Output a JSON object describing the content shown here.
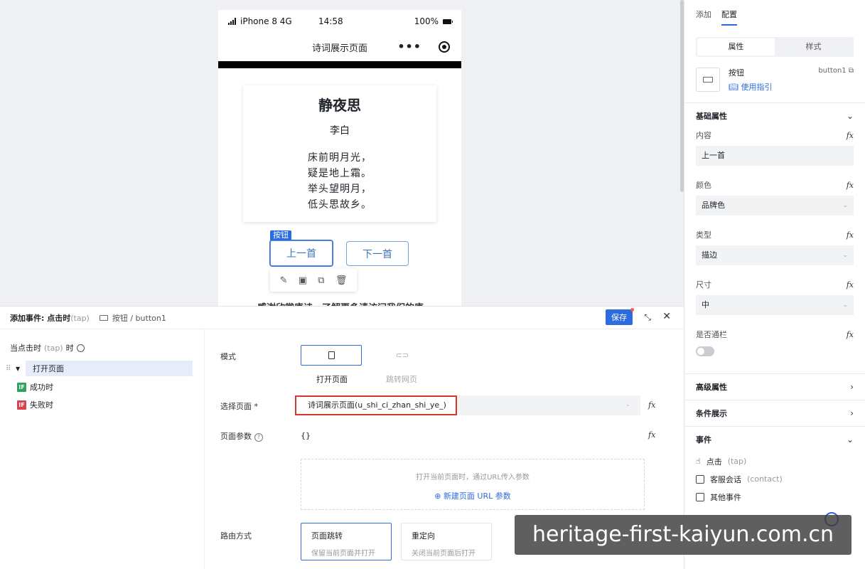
{
  "phone": {
    "status": {
      "carrier": "iPhone 8  4G",
      "time": "14:58",
      "battery": "100%"
    },
    "nav_title": "诗词展示页面",
    "poem": {
      "title": "静夜思",
      "author": "李白",
      "lines": [
        "床前明月光，",
        "疑是地上霜。",
        "举头望明月，",
        "低头思故乡。"
      ]
    },
    "selected_tag": "按钮",
    "prev_button": "上一首",
    "next_button": "下一首",
    "cut_text": "感谢欣赏唐诗，了解更多请访问我们的唐"
  },
  "right_panel": {
    "tabs": [
      "添加",
      "配置"
    ],
    "segments": [
      "属性",
      "样式"
    ],
    "component": {
      "name": "按钮",
      "id": "button1",
      "guide": "使用指引"
    },
    "sections": {
      "basic": "基础属性",
      "advanced": "高级属性",
      "condition": "条件展示",
      "events": "事件"
    },
    "props": {
      "content_label": "内容",
      "content_value": "上一首",
      "color_label": "颜色",
      "color_value": "品牌色",
      "type_label": "类型",
      "type_value": "描边",
      "size_label": "尺寸",
      "size_value": "中",
      "block_label": "是否通栏"
    },
    "fx": "fx",
    "events": [
      {
        "label": "点击",
        "hint": "(tap)"
      },
      {
        "label": "客服会话",
        "hint": "(contact)"
      },
      {
        "label": "其他事件",
        "hint": ""
      }
    ]
  },
  "bottom_panel": {
    "title": "添加事件: 点击时",
    "title_hint": "(tap)",
    "crumb": "按钮 / button1",
    "save": "保存",
    "tree": {
      "head": "当点击时",
      "head_hint": "(tap)",
      "head_suffix": "时",
      "action": "打开页面",
      "success": "成功时",
      "fail": "失败时",
      "if_badge": "IF"
    },
    "form": {
      "mode_label": "模式",
      "mode_open": "打开页面",
      "mode_jump": "跳转网页",
      "page_label": "选择页面 *",
      "page_value": "诗词展示页面(u_shi_ci_zhan_shi_ye_)",
      "params_label": "页面参数",
      "params_value": "{}",
      "params_hint": "打开当前页面时，通过URL传入参数",
      "params_add": "新建页面 URL 参数",
      "route_label": "路由方式",
      "route_push_title": "页面跳转",
      "route_push_desc": "保留当前页面并打开",
      "route_redirect_title": "重定向",
      "route_redirect_desc": "关闭当前页面后打开"
    }
  },
  "watermark": "heritage-first-kaiyun.com.cn",
  "colors": {
    "accent": "#2c6cde",
    "highlight_red": "#d9362b"
  }
}
